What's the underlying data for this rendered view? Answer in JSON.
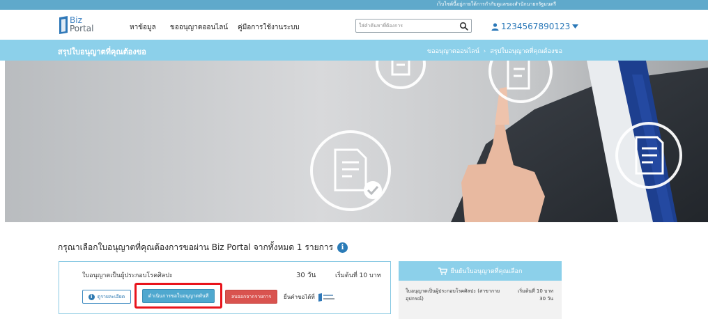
{
  "gov_strip": {
    "text": "เว็บไซต์นี้อยู่ภายใต้การกำกับดูแลของสำนักนายกรัฐมนตรี"
  },
  "header": {
    "logo": {
      "line1": "Biz",
      "line2": "Portal"
    },
    "menu": [
      "หาข้อมูล",
      "ขออนุญาตออนไลน์",
      "คู่มือการใช้งานระบบ"
    ],
    "search": {
      "placeholder": "ใส่คำค้นหาที่ต้องการ",
      "value": ""
    },
    "user": {
      "name": "1234567890123"
    }
  },
  "subbar": {
    "title": "สรุปใบอนุญาตที่คุณต้องขอ",
    "breadcrumb": [
      "ขออนุญาตออนไลน์",
      "สรุปใบอนุญาตที่คุณต้องขอ"
    ],
    "breadcrumb_sep": "›"
  },
  "main": {
    "prompt": "กรุณาเลือกใบอนุญาตที่คุณต้องการขอผ่าน Biz Portal จากทั้งหมด 1 รายการ",
    "license": {
      "name": "ใบอนุญาตเป็นผู้ประกอบโรคศิลปะ",
      "days": "30 วัน",
      "price": "เริ่มต้นที่ 10 บาท",
      "buttons": {
        "detail": "ดูรายละเอียด",
        "proceed": "ดำเนินการขอใบอนุญาตทันที",
        "remove": "ลบออกจากรายการ"
      },
      "apply_via": "ยื่นคำขอได้ที่"
    }
  },
  "cart": {
    "title": "ยืนยันใบอนุญาตที่คุณเลือก",
    "item_name": "ใบอนุญาตเป็นผู้ประกอบโรคศิลปะ (สาขากาย อุปกรณ์)",
    "item_price": "เริ่มต้นที่ 10 บาท",
    "item_days": "30 วัน"
  },
  "colors": {
    "gov_strip": "#5fa9cb",
    "subbar": "#8cd0ea",
    "primary_blue": "#2a7bb7",
    "proceed_button": "#4fa8cf",
    "remove_button": "#d9534f",
    "highlight_outline": "#e8141c"
  }
}
